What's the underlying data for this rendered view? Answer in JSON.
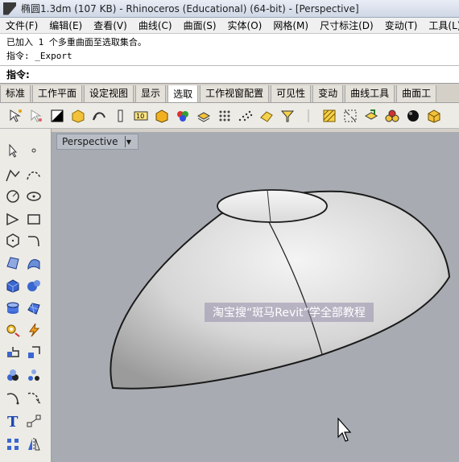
{
  "window": {
    "title": "椭圆1.3dm (107 KB) - Rhinoceros (Educational) (64-bit) - [Perspective]"
  },
  "menu": {
    "items": [
      "文件(F)",
      "编辑(E)",
      "查看(V)",
      "曲线(C)",
      "曲面(S)",
      "实体(O)",
      "网格(M)",
      "尺寸标注(D)",
      "变动(T)",
      "工具(L)"
    ]
  },
  "history": {
    "line1": "已加入 1 个多重曲面至选取集合。",
    "line2": "指令: _Export"
  },
  "command": {
    "prompt": "指令:",
    "value": ""
  },
  "tabs": {
    "items": [
      "标准",
      "工作平面",
      "设定视图",
      "显示",
      "选取",
      "工作视窗配置",
      "可见性",
      "变动",
      "曲线工具",
      "曲面工"
    ],
    "active_index": 4
  },
  "viewport": {
    "name": "Perspective",
    "dropdown_glyph": "▼"
  },
  "watermark": {
    "text": "淘宝搜“斑马Revit”学全部教程"
  },
  "colors": {
    "viewport_bg": "#a8acb2",
    "chrome_bg": "#d4d0c8"
  }
}
